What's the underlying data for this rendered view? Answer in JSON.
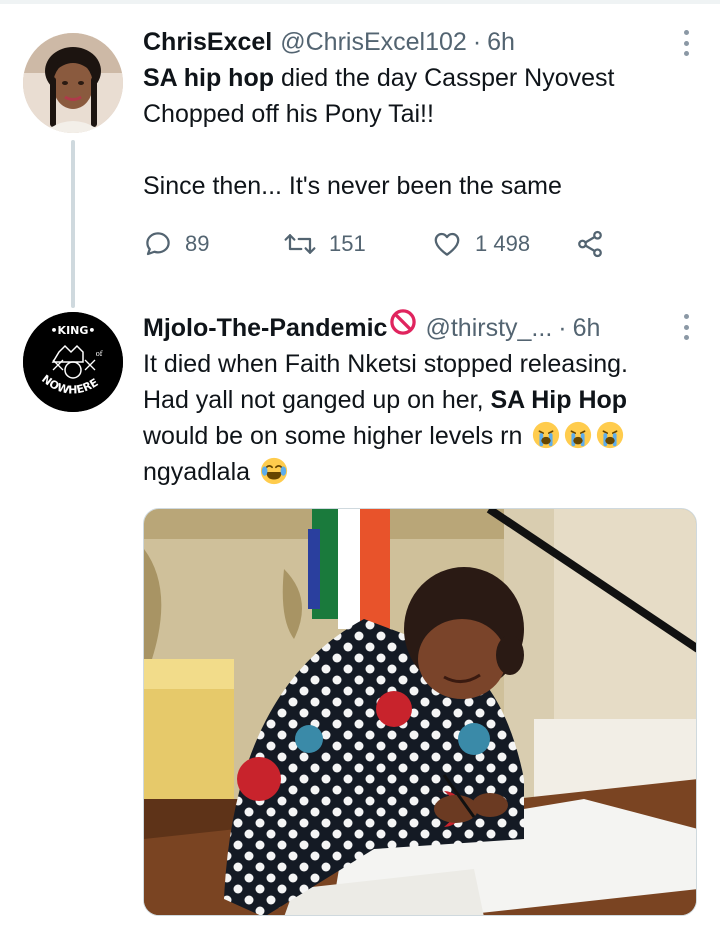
{
  "tweets": [
    {
      "name": "ChrisExcel",
      "handle": "@ChrisExcel102",
      "separator": "·",
      "time": "6h",
      "text_bold": "SA hip hop",
      "text_line1_rest": " died the day Cassper Nyovest",
      "text_line2": "Chopped off his Pony Tai!!",
      "text_para2": "Since then... It's never been the same",
      "replies": "89",
      "retweets": "151",
      "likes": "1 498"
    },
    {
      "name": "Mjolo-The-Pandemic",
      "handle": "@thirsty_...",
      "separator": "·",
      "time": "6h",
      "text_line1": "It died when Faith Nketsi stopped releasing.",
      "text_line2_pre": "Had yall not ganged up on her, ",
      "text_line2_bold": "SA Hip Hop",
      "text_line3": "would be on some higher levels rn",
      "text_line4": "ngyadlala",
      "avatar_text_top": "•KING•",
      "avatar_text_bottom": "NOWHERE",
      "avatar_text_of": "of"
    }
  ],
  "icons": [
    "more-options-icon",
    "reply-icon",
    "retweet-icon",
    "like-icon",
    "share-icon",
    "prohibited-icon",
    "crying-face-emoji",
    "laughing-face-emoji"
  ],
  "colors": {
    "text": "#0f1419",
    "secondary": "#536471",
    "thread_line": "#cfd9de",
    "prohibit_red": "#e0245e"
  }
}
